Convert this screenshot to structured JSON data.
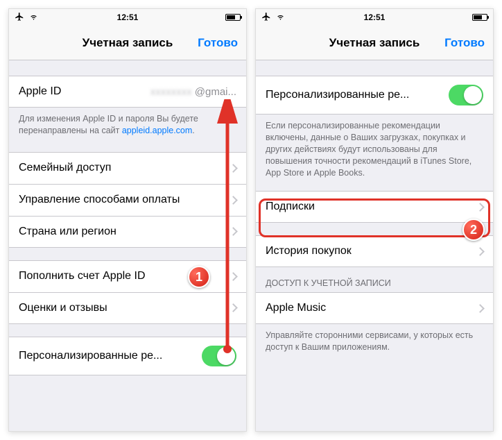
{
  "status": {
    "time": "12:51"
  },
  "nav": {
    "title": "Учетная запись",
    "done": "Готово"
  },
  "left": {
    "apple_id_label": "Apple ID",
    "apple_id_value": "@gmai...",
    "footer1_a": "Для изменения Apple ID и пароля Вы будете перенаправлены на сайт ",
    "footer1_link": "appleid.apple.com",
    "footer1_b": ".",
    "family": "Семейный доступ",
    "payment": "Управление способами оплаты",
    "country": "Страна или регион",
    "topup": "Пополнить счет Apple ID",
    "ratings": "Оценки и отзывы",
    "personal": "Персонализированные ре..."
  },
  "right": {
    "personal": "Персонализированные ре...",
    "personal_footer": "Если персонализированные рекомендации включены, данные о Ваших загрузках, покупках и других действиях будут использованы для повышения точности рекомендаций в iTunes Store, App Store и Apple Books.",
    "subs": "Подписки",
    "history": "История покупок",
    "access_header": "ДОСТУП К УЧЕТНОЙ ЗАПИСИ",
    "apple_music": "Apple Music",
    "access_footer": "Управляйте сторонними сервисами, у которых есть доступ к Вашим приложениям."
  },
  "annotations": {
    "badge1": "1",
    "badge2": "2"
  }
}
